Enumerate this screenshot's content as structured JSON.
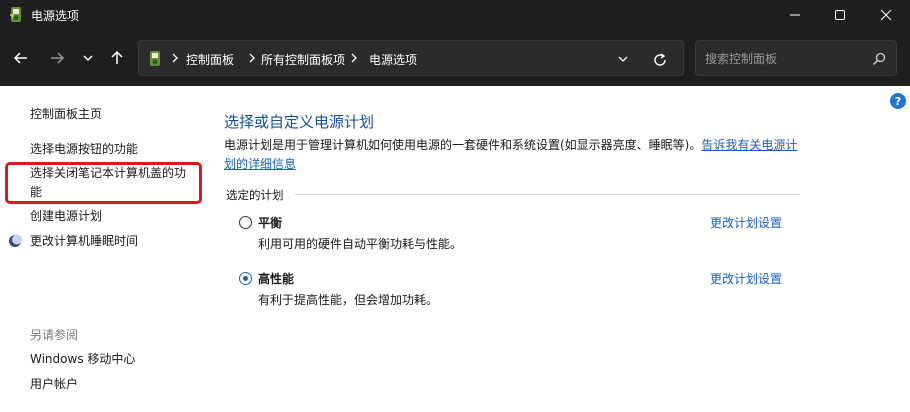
{
  "window": {
    "title": "电源选项"
  },
  "address": {
    "crumbs": [
      "控制面板",
      "所有控制面板项",
      "电源选项"
    ]
  },
  "search": {
    "placeholder": "搜索控制面板"
  },
  "sidebar": {
    "home": "控制面板主页",
    "items": [
      "选择电源按钮的功能",
      "选择关闭笔记本计算机盖的功能",
      "创建电源计划",
      "更改计算机睡眠时间"
    ],
    "see_also_label": "另请参阅",
    "see_also": [
      "Windows 移动中心",
      "用户帐户"
    ]
  },
  "main": {
    "title": "选择或自定义电源计划",
    "description": "电源计划是用于管理计算机如何使用电源的一套硬件和系统设置(如显示器亮度、睡眠等)。",
    "description_link": "告诉我有关电源计划的详细信息",
    "selected_plans_label": "选定的计划",
    "plans": [
      {
        "name": "平衡",
        "description": "利用可用的硬件自动平衡功耗与性能。",
        "selected": false,
        "link": "更改计划设置"
      },
      {
        "name": "高性能",
        "description": "有利于提高性能，但会增加功耗。",
        "selected": true,
        "link": "更改计划设置"
      }
    ]
  },
  "colors": {
    "titlebar": "#1f1f1f",
    "accent": "#1a5fc0",
    "highlight": "#e0161b"
  },
  "icons": {
    "app": "power-options-icon",
    "help": "help-icon"
  }
}
